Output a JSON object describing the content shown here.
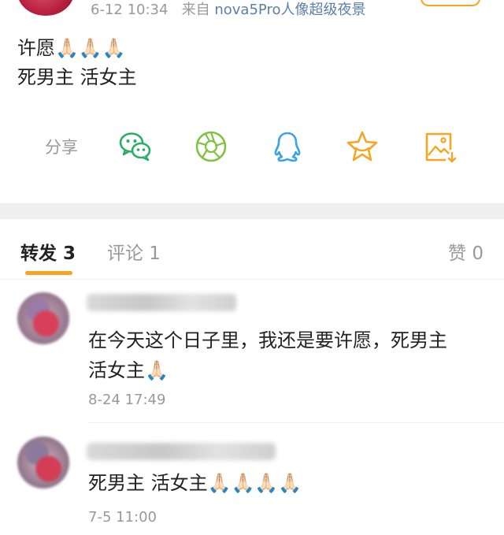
{
  "post": {
    "time": "6-12 10:34",
    "source_prefix": "来自",
    "source": "nova5Pro人像超级夜景",
    "line1": "许愿🙏🏻🙏🏻🙏🏻",
    "line2": "死男主 活女主"
  },
  "share": {
    "label": "分享",
    "icons": [
      "wechat-icon",
      "moments-icon",
      "qq-icon",
      "favorite-icon",
      "save-image-icon"
    ]
  },
  "tabs": {
    "repost": "转发 3",
    "comment": "评论 1",
    "like": "赞 0"
  },
  "reposts": [
    {
      "text_line1": "在今天这个日子里，我还是要许愿，死男主",
      "text_line2": "活女主🙏🏻",
      "time": "8-24 17:49"
    },
    {
      "text_line1": "死男主  活女主🙏🏻🙏🏻🙏🏻🙏🏻",
      "time": "7-5 11:00"
    }
  ],
  "colors": {
    "accent": "#f5a623",
    "wechat": "#2aae67",
    "moments": "#7fc241",
    "qq": "#3aa3e3",
    "favorite": "#f5a623",
    "save": "#f5a623",
    "muted": "#999999",
    "source_link": "#5a7fa8"
  }
}
